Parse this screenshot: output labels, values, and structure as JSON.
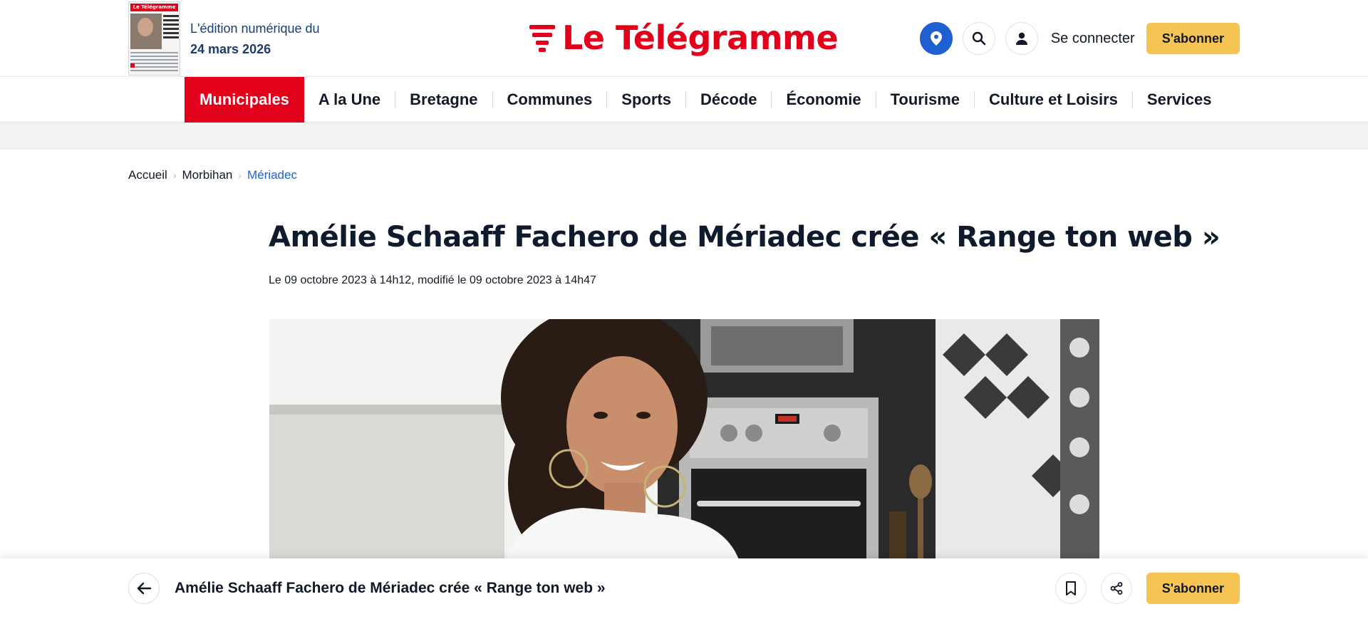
{
  "header": {
    "edition_label": "L'édition numérique du",
    "edition_date": "24 mars 2026",
    "edition_thumbnail_masthead": "Le Télégramme",
    "logo_text": "Le Télégramme",
    "connect_label": "Se connecter",
    "subscribe_label": "S'abonner",
    "icons": [
      "location-icon",
      "search-icon",
      "user-icon"
    ]
  },
  "nav": {
    "items": [
      {
        "label": "Municipales",
        "active": true
      },
      {
        "label": "A la Une"
      },
      {
        "label": "Bretagne"
      },
      {
        "label": "Communes"
      },
      {
        "label": "Sports"
      },
      {
        "label": "Décode"
      },
      {
        "label": "Économie"
      },
      {
        "label": "Tourisme"
      },
      {
        "label": "Culture et Loisirs"
      },
      {
        "label": "Services"
      }
    ]
  },
  "breadcrumb": {
    "items": [
      "Accueil",
      "Morbihan",
      "Mériadec"
    ]
  },
  "article": {
    "title": "Amélie Schaaff Fachero de Mériadec crée « Range ton web »",
    "date": "Le 09 octobre 2023 à 14h12, modifié le 09 octobre 2023 à 14h47"
  },
  "sticky_bar": {
    "title": "Amélie Schaaff Fachero de Mériadec crée « Range ton web »",
    "subscribe_label": "S'abonner",
    "icons": [
      "arrow-left-icon",
      "bookmark-icon",
      "share-icon"
    ]
  },
  "colors": {
    "brand_red": "#e2001a",
    "accent_yellow": "#f6c453",
    "link_blue": "#1f5fd1",
    "edition_blue": "#1d3c6e"
  }
}
